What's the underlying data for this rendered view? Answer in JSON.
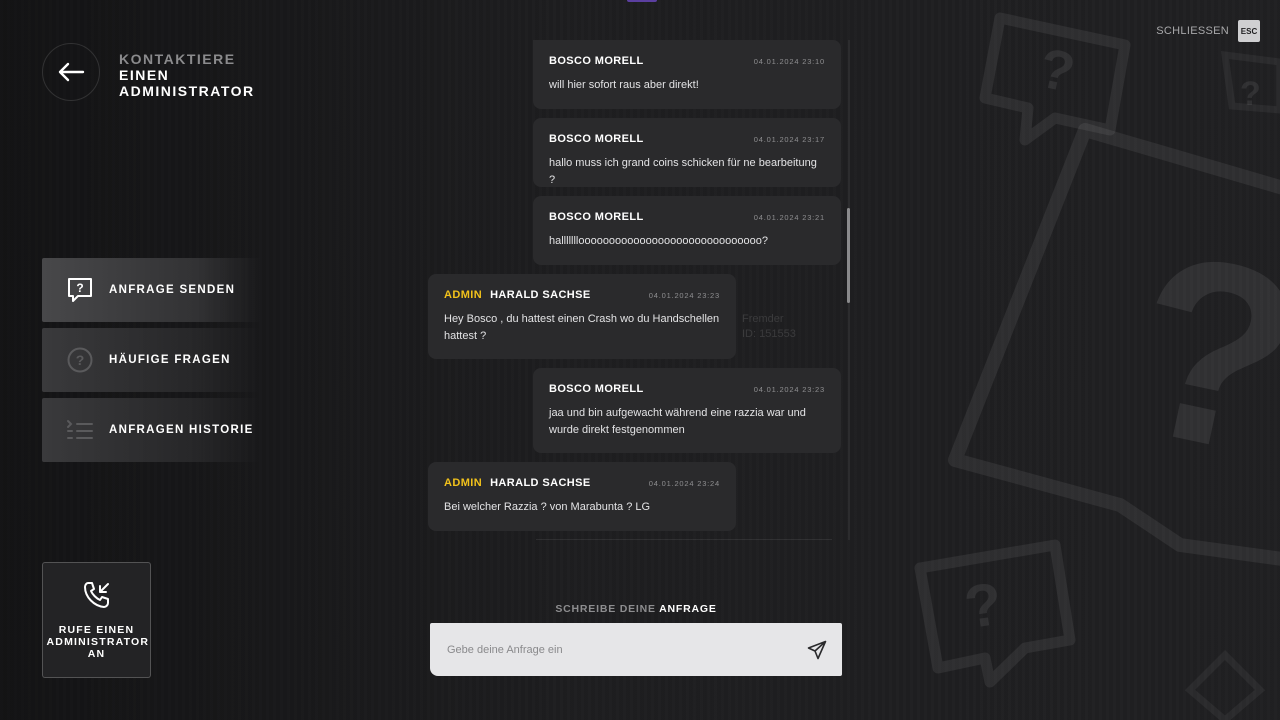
{
  "header": {
    "title_line1": "KONTAKTIERE",
    "title_line2": "EINEN",
    "title_line3": "ADMINISTRATOR",
    "back_icon": "arrow-left-icon"
  },
  "close": {
    "label": "SCHLIESSEN",
    "key": "ESC"
  },
  "menu": {
    "items": [
      {
        "label": "ANFRAGE SENDEN",
        "icon": "question-bubble-icon",
        "active": true
      },
      {
        "label": "HÄUFIGE FRAGEN",
        "icon": "question-circle-icon",
        "active": false
      },
      {
        "label": "ANFRAGEN HISTORIE",
        "icon": "list-icon",
        "active": false
      }
    ]
  },
  "call": {
    "label": "RUFE EINEN ADMINISTRATOR AN",
    "icon": "phone-incoming-icon"
  },
  "chat": {
    "messages": [
      {
        "type": "user",
        "role": "",
        "name": "BOSCO MORELL",
        "time": "04.01.2024 23:10",
        "text": "will hier sofort raus aber direkt!"
      },
      {
        "type": "user",
        "role": "",
        "name": "BOSCO MORELL",
        "time": "04.01.2024 23:17",
        "text": "hallo muss ich grand coins schicken für ne bearbeitung ?"
      },
      {
        "type": "user",
        "role": "",
        "name": "BOSCO MORELL",
        "time": "04.01.2024 23:21",
        "text": "hallllllloooooooooooooooooooooooooooooo?"
      },
      {
        "type": "admin",
        "role": "ADMIN",
        "name": "HARALD SACHSE",
        "time": "04.01.2024 23:23",
        "text": "Hey Bosco , du hattest einen Crash wo du Handschellen hattest ?"
      },
      {
        "type": "user",
        "role": "",
        "name": "BOSCO MORELL",
        "time": "04.01.2024 23:23",
        "text": "jaa und bin aufgewacht während eine razzia war und wurde direkt festgenommen"
      },
      {
        "type": "admin",
        "role": "ADMIN",
        "name": "HARALD SACHSE",
        "time": "04.01.2024 23:24",
        "text": "Bei welcher Razzia ? von Marabunta ? LG"
      }
    ],
    "ghost_line1": "Fremder",
    "ghost_line2": "ID: 151553"
  },
  "composer": {
    "label_a": "SCHREIBE DEINE",
    "label_b": "ANFRAGE",
    "placeholder": "Gebe deine Anfrage ein",
    "send_icon": "send-icon"
  },
  "colors": {
    "accent": "#f2c21b",
    "bubble": "#2a2a2c",
    "input_bg": "#e6e6e8"
  }
}
